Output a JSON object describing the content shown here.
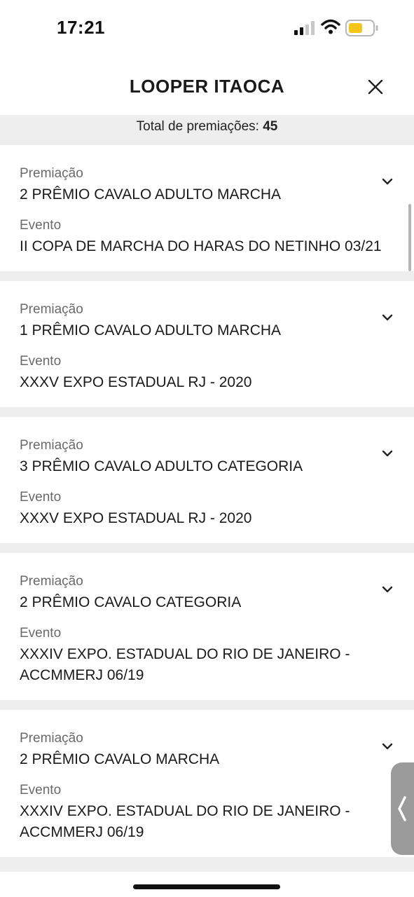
{
  "status_bar": {
    "time": "17:21",
    "icons": [
      "cellular-signal-icon",
      "wifi-icon",
      "battery-icon"
    ],
    "battery_color": "#f5c518"
  },
  "header": {
    "title": "LOOPER ITAOCA",
    "close_icon": "close-icon"
  },
  "summary": {
    "label": "Total de premiações:",
    "count": "45"
  },
  "cards": [
    {
      "award_label": "Premiação",
      "award": "2 PRÊMIO CAVALO ADULTO MARCHA",
      "event_label": "Evento",
      "event": "II COPA DE MARCHA DO HARAS DO NETINHO 03/21"
    },
    {
      "award_label": "Premiação",
      "award": "1 PRÊMIO CAVALO ADULTO MARCHA",
      "event_label": "Evento",
      "event": "XXXV EXPO ESTADUAL RJ - 2020"
    },
    {
      "award_label": "Premiação",
      "award": "3 PRÊMIO CAVALO ADULTO CATEGORIA",
      "event_label": "Evento",
      "event": "XXXV EXPO ESTADUAL RJ - 2020"
    },
    {
      "award_label": "Premiação",
      "award": "2 PRÊMIO CAVALO CATEGORIA",
      "event_label": "Evento",
      "event": "XXXIV EXPO. ESTADUAL DO RIO DE JANEIRO - ACCMMERJ 06/19"
    },
    {
      "award_label": "Premiação",
      "award": "2 PRÊMIO CAVALO MARCHA",
      "event_label": "Evento",
      "event": "XXXIV EXPO. ESTADUAL DO RIO DE JANEIRO - ACCMMERJ 06/19"
    }
  ]
}
